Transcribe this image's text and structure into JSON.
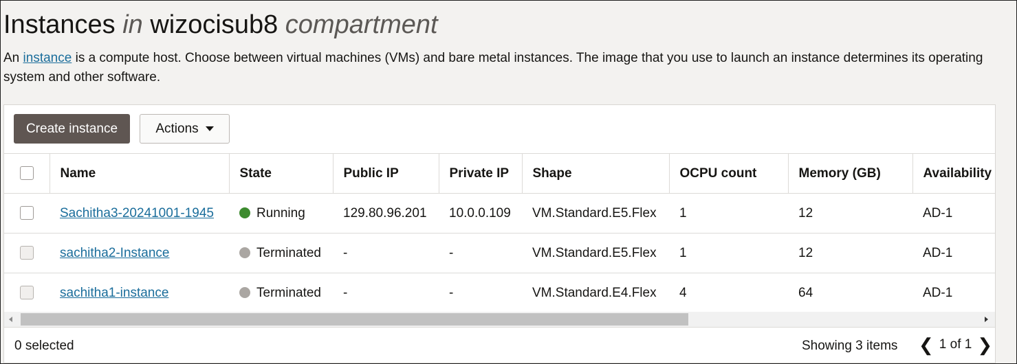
{
  "header": {
    "title_main": "Instances",
    "title_in": "in",
    "compartment": "wizocisub8",
    "title_suffix": "compartment"
  },
  "intro": {
    "prefix": "An ",
    "link": "instance",
    "text": " is a compute host. Choose between virtual machines (VMs) and bare metal instances. The image that you use to launch an instance determines its operating system and other software."
  },
  "toolbar": {
    "create_label": "Create instance",
    "actions_label": "Actions"
  },
  "table": {
    "columns": [
      "Name",
      "State",
      "Public IP",
      "Private IP",
      "Shape",
      "OCPU count",
      "Memory (GB)",
      "Availability"
    ],
    "rows": [
      {
        "name": "Sachitha3-20241001-1945",
        "state": "Running",
        "state_color": "#3d8b2f",
        "public_ip": "129.80.96.201",
        "private_ip": "10.0.0.109",
        "shape": "VM.Standard.E5.Flex",
        "ocpu": "1",
        "memory": "12",
        "availability": "AD-1"
      },
      {
        "name": "sachitha2-Instance",
        "state": "Terminated",
        "state_color": "#aaa6a2",
        "public_ip": "-",
        "private_ip": "-",
        "shape": "VM.Standard.E5.Flex",
        "ocpu": "1",
        "memory": "12",
        "availability": "AD-1"
      },
      {
        "name": "sachitha1-instance",
        "state": "Terminated",
        "state_color": "#aaa6a2",
        "public_ip": "-",
        "private_ip": "-",
        "shape": "VM.Standard.E4.Flex",
        "ocpu": "4",
        "memory": "64",
        "availability": "AD-1"
      }
    ]
  },
  "footer": {
    "selected": "0 selected",
    "showing": "Showing 3 items",
    "page": "1 of 1"
  },
  "icons": {
    "actions_caret": "caret-down-icon",
    "prev": "chevron-left-icon",
    "next": "chevron-right-icon"
  }
}
